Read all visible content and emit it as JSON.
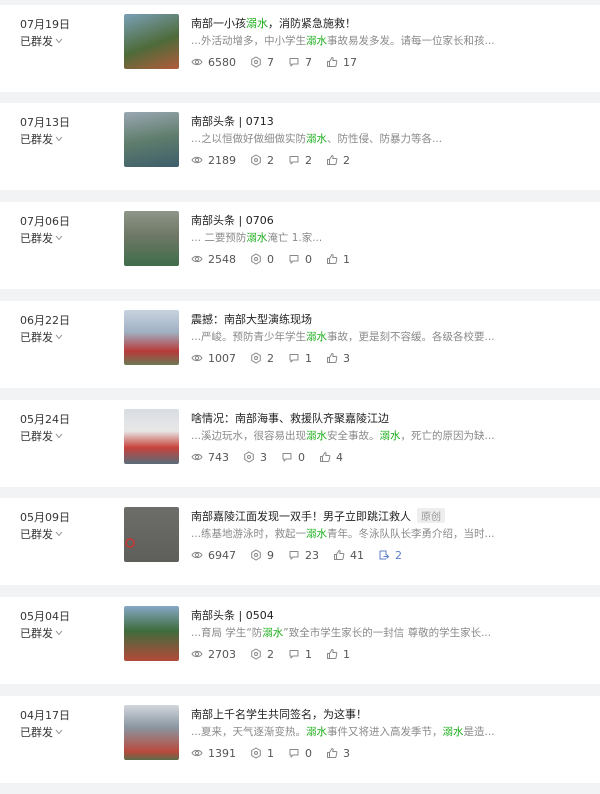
{
  "status_label": "已群发",
  "highlight_color": "#1aad19",
  "articles": [
    {
      "date": "07月19日",
      "title": [
        "南部一小孩",
        "溺水",
        "，消防紧急施救！"
      ],
      "excerpt": [
        "...外活动增多，中小学生",
        "溺水",
        "事故易发多发。请每一位家长和孩..."
      ],
      "reads": "6580",
      "wows": "7",
      "comments": "7",
      "likes": "17"
    },
    {
      "date": "07月13日",
      "title": [
        "南部头条 | 0713"
      ],
      "excerpt": [
        "...之以恒做好做细做实防",
        "溺水",
        "、防性侵、防暴力等各..."
      ],
      "reads": "2189",
      "wows": "2",
      "comments": "2",
      "likes": "2"
    },
    {
      "date": "07月06日",
      "title": [
        "南部头条 | 0706"
      ],
      "excerpt": [
        "... 二要预防",
        "溺水",
        "淹亡 1.家..."
      ],
      "reads": "2548",
      "wows": "0",
      "comments": "0",
      "likes": "1"
    },
    {
      "date": "06月22日",
      "title": [
        "震撼：南部大型演练现场"
      ],
      "excerpt": [
        "...严峻。预防青少年学生",
        "溺水",
        "事故，更是刻不容缓。各级各校要..."
      ],
      "reads": "1007",
      "wows": "2",
      "comments": "1",
      "likes": "3"
    },
    {
      "date": "05月24日",
      "title": [
        "啥情况：南部海事、救援队齐聚嘉陵江边"
      ],
      "excerpt": [
        "...溪边玩水，很容易出现",
        "溺水",
        "安全事故。",
        "溺水",
        "，死亡的原因为缺..."
      ],
      "reads": "743",
      "wows": "3",
      "comments": "0",
      "likes": "4"
    },
    {
      "date": "05月09日",
      "title": [
        "南部嘉陵江面发现一双手！男子立即跳江救人"
      ],
      "tag": "原创",
      "excerpt": [
        "...练基地游泳时，救起一",
        "溺水",
        "青年。冬泳队队长李勇介绍，当时..."
      ],
      "reads": "6947",
      "wows": "9",
      "comments": "23",
      "likes": "41",
      "shares": "2"
    },
    {
      "date": "05月04日",
      "title": [
        "南部头条 | 0504"
      ],
      "excerpt": [
        "...育局 学生“防",
        "溺水",
        "”致全市学生家长的一封信 尊敬的学生家长..."
      ],
      "reads": "2703",
      "wows": "2",
      "comments": "1",
      "likes": "1"
    },
    {
      "date": "04月17日",
      "title": [
        "南部上千名学生共同签名，为这事！"
      ],
      "excerpt": [
        "...夏来，天气逐渐变热。",
        "溺水",
        "事件又将进入高发季节，",
        "溺水",
        "是造..."
      ],
      "reads": "1391",
      "wows": "1",
      "comments": "0",
      "likes": "3"
    }
  ]
}
